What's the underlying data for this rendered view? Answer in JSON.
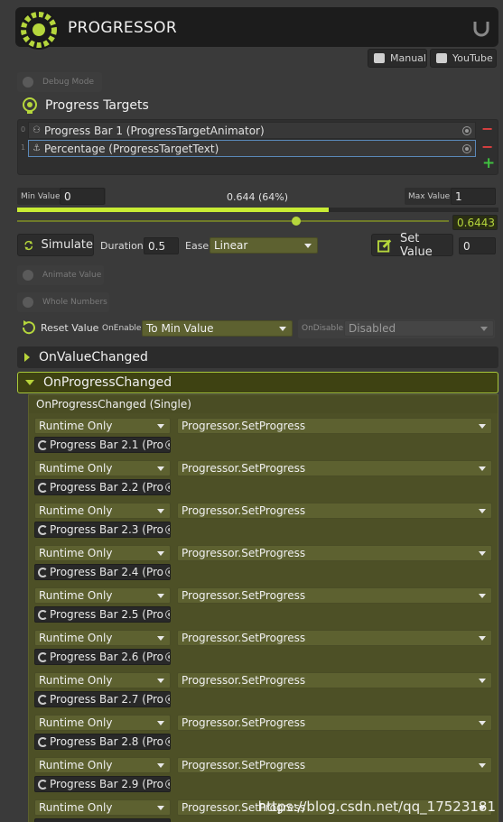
{
  "header": {
    "title": "PROGRESSOR"
  },
  "toolbar": {
    "manual_label": "Manual",
    "youtube_label": "YouTube"
  },
  "debug": {
    "label": "Debug Mode"
  },
  "targets": {
    "title": "Progress Targets",
    "items": [
      {
        "index": "0",
        "label": "Progress Bar 1 (ProgressTargetAnimator)"
      },
      {
        "index": "1",
        "label": "Percentage (ProgressTargetText)"
      }
    ]
  },
  "values": {
    "min_label": "Min Value",
    "min": "0",
    "center": "0.644 (64%)",
    "max_label": "Max Value",
    "max": "1",
    "slider_value": "0.6443",
    "progress": 0.644
  },
  "simulate": {
    "button_label": "Simulate",
    "duration_label": "Duration",
    "duration": "0.5",
    "ease_label": "Ease",
    "ease": "Linear",
    "set_value_label": "Set Value",
    "set_value": "0"
  },
  "options": {
    "animate_value": "Animate Value",
    "whole_numbers": "Whole Numbers"
  },
  "reset": {
    "label": "Reset Value",
    "on_enable_label": "OnEnable",
    "on_enable": "To Min Value",
    "on_disable_label": "OnDisable",
    "on_disable": "Disabled"
  },
  "events": {
    "on_value_changed": "OnValueChanged",
    "on_progress_changed": "OnProgressChanged",
    "panel_header": "OnProgressChanged (Single)",
    "rows": [
      {
        "mode": "Runtime Only",
        "method": "Progressor.SetProgress",
        "object": "Progress Bar 2.1 (Pro"
      },
      {
        "mode": "Runtime Only",
        "method": "Progressor.SetProgress",
        "object": "Progress Bar 2.2 (Pro"
      },
      {
        "mode": "Runtime Only",
        "method": "Progressor.SetProgress",
        "object": "Progress Bar 2.3 (Pro"
      },
      {
        "mode": "Runtime Only",
        "method": "Progressor.SetProgress",
        "object": "Progress Bar 2.4 (Pro"
      },
      {
        "mode": "Runtime Only",
        "method": "Progressor.SetProgress",
        "object": "Progress Bar 2.5 (Pro"
      },
      {
        "mode": "Runtime Only",
        "method": "Progressor.SetProgress",
        "object": "Progress Bar 2.6 (Pro"
      },
      {
        "mode": "Runtime Only",
        "method": "Progressor.SetProgress",
        "object": "Progress Bar 2.7 (Pro"
      },
      {
        "mode": "Runtime Only",
        "method": "Progressor.SetProgress",
        "object": "Progress Bar 2.8 (Pro"
      },
      {
        "mode": "Runtime Only",
        "method": "Progressor.SetProgress",
        "object": "Progress Bar 2.9 (Pro"
      },
      {
        "mode": "Runtime Only",
        "method": "Progressor.SetProgress",
        "object": ""
      }
    ]
  },
  "watermark": "https://blog.csdn.net/qq_17523181",
  "colors": {
    "accent": "#b5d63c",
    "panel": "#4d5026",
    "background": "#3a3a3a"
  }
}
